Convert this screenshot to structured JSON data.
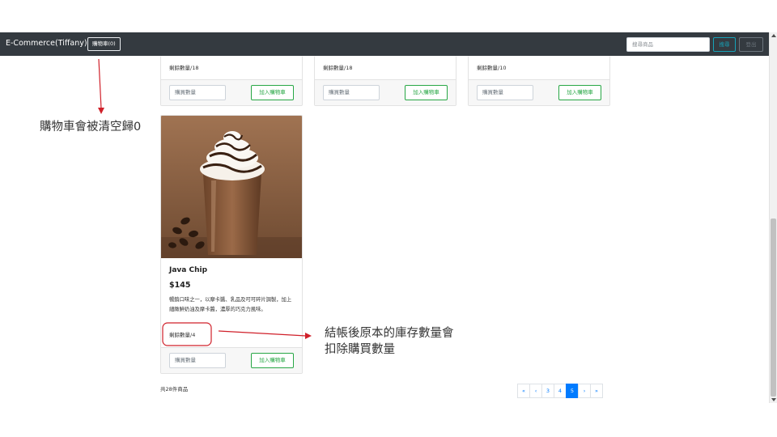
{
  "navbar": {
    "brand": "E-Commerce(Tiffany)",
    "cart_label": "購物車(0)",
    "search_placeholder": "搜尋商品",
    "search_label": "搜尋",
    "logout_label": "登出"
  },
  "top_cards": [
    {
      "stock": "剩餘數量/18",
      "qty_placeholder": "購買數量",
      "add_label": "加入購物車"
    },
    {
      "stock": "剩餘數量/18",
      "qty_placeholder": "購買數量",
      "add_label": "加入購物車"
    },
    {
      "stock": "剩餘數量/10",
      "qty_placeholder": "購買數量",
      "add_label": "加入購物車"
    }
  ],
  "product": {
    "name": "Java Chip",
    "price": "$145",
    "description": "暢銷口味之一，以摩卡醬、乳品及可可碎片調製，加上細緻鮮奶油及摩卡醬，濃厚的巧克力風味。",
    "stock": "剩餘數量/4",
    "qty_placeholder": "購買數量",
    "add_label": "加入購物車"
  },
  "total_count": "共28件商品",
  "pagination": {
    "items": [
      "«",
      "‹",
      "3",
      "4",
      "5",
      "›",
      "»"
    ],
    "active": "5"
  },
  "annotations": {
    "cart_note": "購物車會被清空歸0",
    "stock_note_line1": "結帳後原本的庫存數量會",
    "stock_note_line2": "扣除購買數量"
  },
  "colors": {
    "navbar": "#343a40",
    "annotation_red": "#d0202a",
    "success_green": "#28a745",
    "primary_blue": "#007bff",
    "info_teal": "#17a2b8"
  }
}
